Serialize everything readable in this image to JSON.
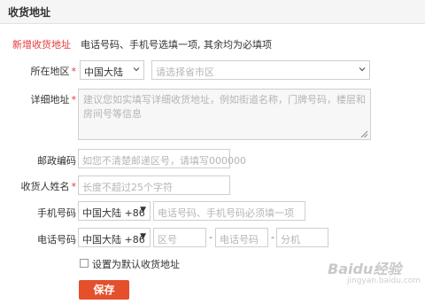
{
  "header": {
    "title": "收货地址"
  },
  "form": {
    "subtitle": "新增收货地址",
    "note": "电话号码、手机号选填一项, 其余均为必填项",
    "required_mark": "*",
    "region": {
      "label": "所在地区",
      "country_value": "中国大陆",
      "area_placeholder": "请选择省市区"
    },
    "address": {
      "label": "详细地址",
      "placeholder": "建议您如实填写详细收货地址，例如街道名称，门牌号码，楼层和房间号等信息"
    },
    "postal": {
      "label": "邮政编码",
      "placeholder": "如您不清楚邮递区号，请填写000000"
    },
    "name": {
      "label": "收货人姓名",
      "placeholder": "长度不超过25个字符"
    },
    "mobile": {
      "label": "手机号码",
      "country_code": "中国大陆 +86",
      "placeholder": "电话号码、手机号码必须填一项"
    },
    "phone": {
      "label": "电话号码",
      "country_code": "中国大陆 +86",
      "area_placeholder": "区号",
      "number_placeholder": "电话号码",
      "ext_placeholder": "分机",
      "separator": "-"
    },
    "default_checkbox": {
      "label": "设置为默认收货地址",
      "checked": false
    },
    "save_label": "保存"
  },
  "watermark": {
    "text": "Baidu经验",
    "sub": "jingyan.baidu.com"
  }
}
